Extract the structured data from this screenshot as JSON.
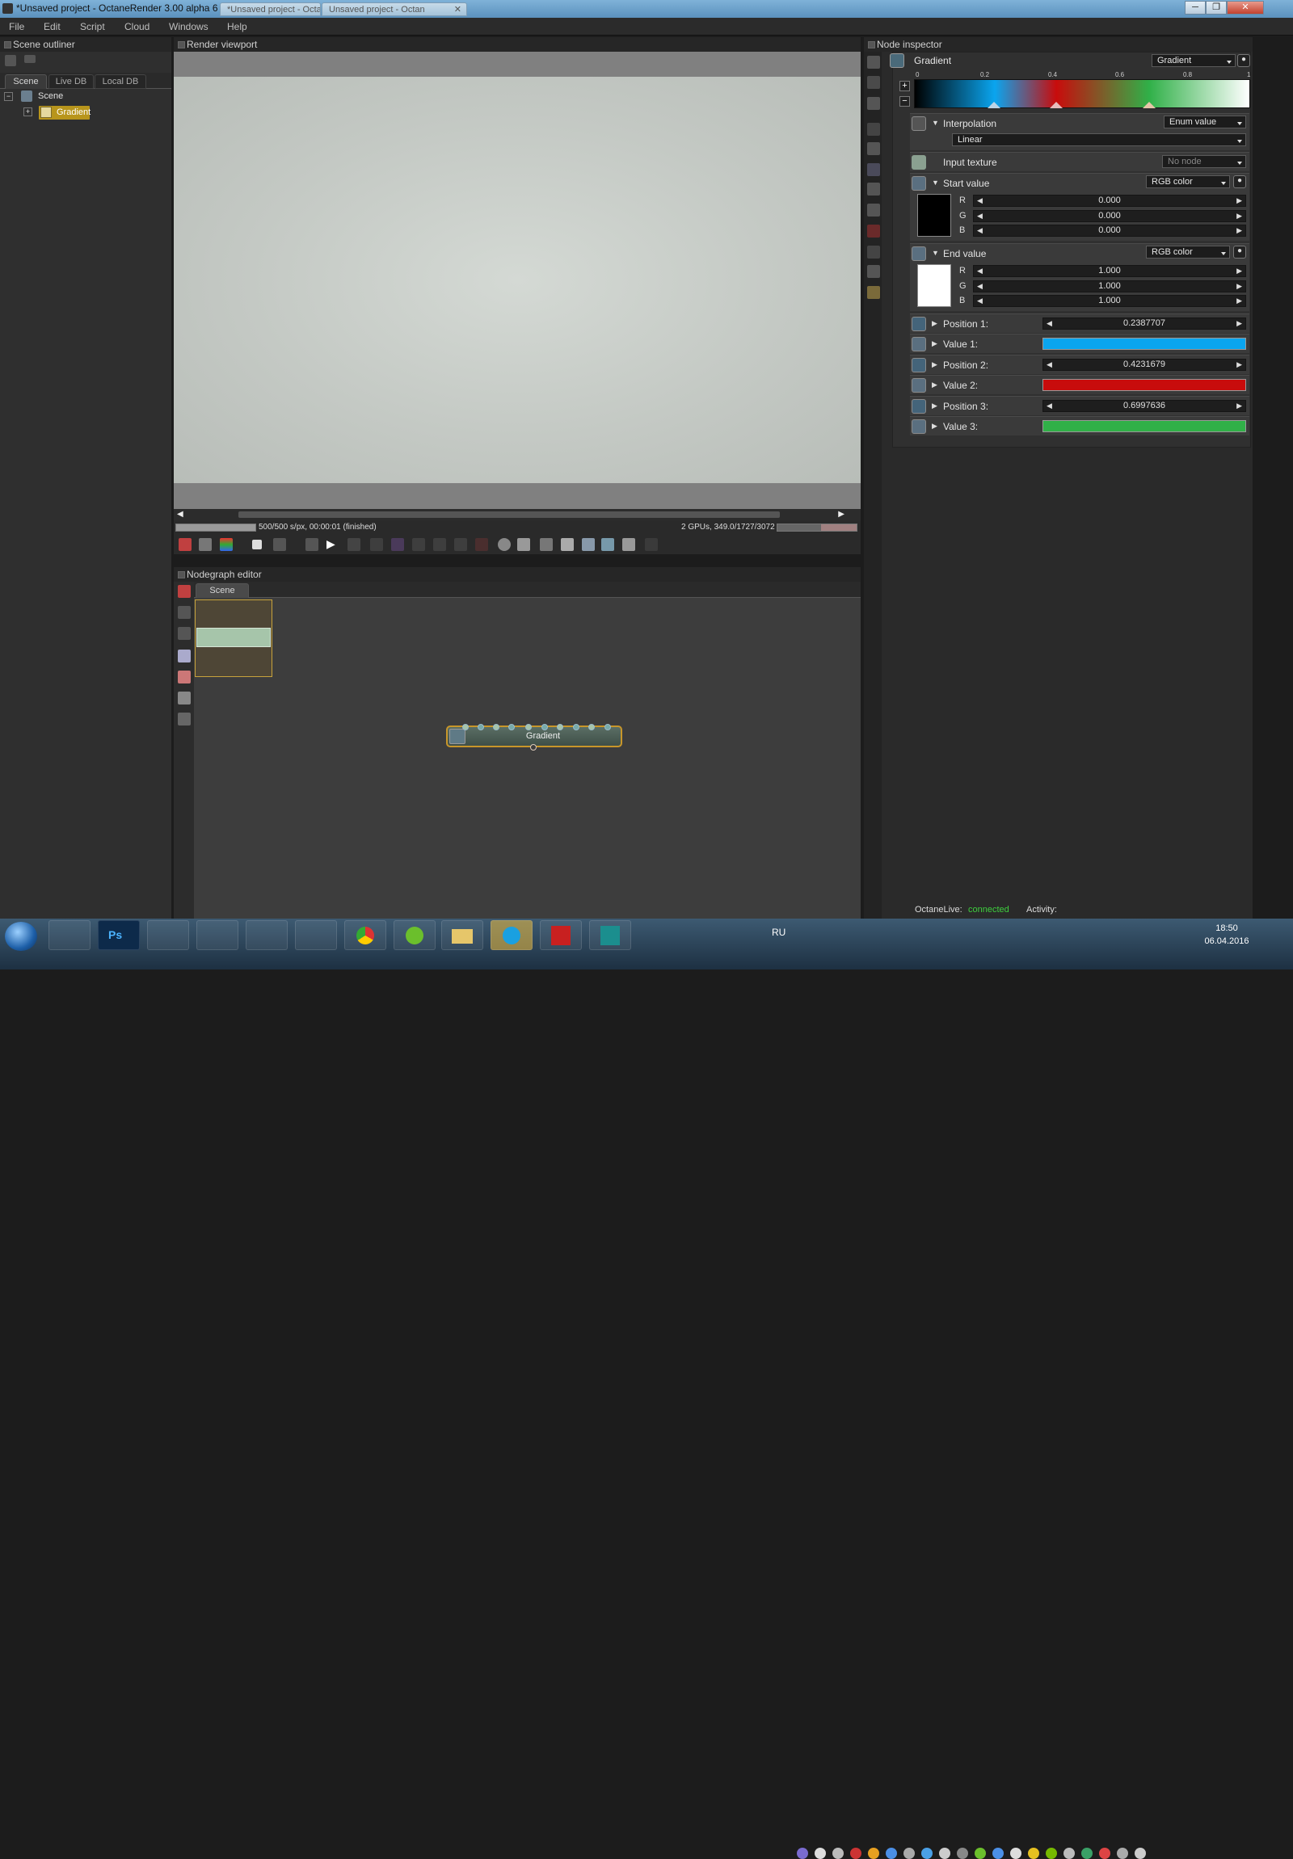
{
  "window": {
    "title": "*Unsaved project - OctaneRender 3.00 alpha 6",
    "browser_tab": "*Unsaved project - Octa",
    "browser_tab2": "Unsaved project - Octan",
    "buttons": [
      "─",
      "❐",
      "✕"
    ]
  },
  "menu": [
    "File",
    "Edit",
    "Script",
    "Cloud",
    "Windows",
    "Help"
  ],
  "outliner": {
    "title": "Scene outliner",
    "tabs": [
      "Scene",
      "Live DB",
      "Local DB"
    ],
    "tree": {
      "root": "Scene",
      "child": "Gradient"
    }
  },
  "viewport": {
    "title": "Render viewport",
    "status_left": "500/500 s/px, 00:00:01 (finished)",
    "status_right": "2 GPUs, 349.0/1727/3072 MB",
    "progress": 1.0,
    "gpu_mem_fraction": 0.55
  },
  "nodegraph": {
    "title": "Nodegraph editor",
    "tab": "Scene",
    "node_label": "Gradient"
  },
  "inspector": {
    "title": "Node inspector",
    "node_name": "Gradient",
    "node_type": "Gradient",
    "gradient_ticks": [
      "0",
      "0.2",
      "0.4",
      "0.6",
      "0.8",
      "1"
    ],
    "interpolation": {
      "label": "Interpolation",
      "type": "Enum value",
      "value": "Linear"
    },
    "input_texture": {
      "label": "Input texture",
      "value": "No node"
    },
    "start": {
      "label": "Start value",
      "type": "RGB color",
      "r": "0.000",
      "g": "0.000",
      "b": "0.000",
      "swatch": "#000000"
    },
    "end": {
      "label": "End value",
      "type": "RGB color",
      "r": "1.000",
      "g": "1.000",
      "b": "1.000",
      "swatch": "#ffffff"
    },
    "channels": [
      "R",
      "G",
      "B"
    ],
    "position1": {
      "label": "Position 1:",
      "value": "0.2387707"
    },
    "value1": {
      "label": "Value 1:",
      "color": "#0aa5ef"
    },
    "position2": {
      "label": "Position 2:",
      "value": "0.4231679"
    },
    "value2": {
      "label": "Value 2:",
      "color": "#c80c0c"
    },
    "position3": {
      "label": "Position 3:",
      "value": "0.6997636"
    },
    "value3": {
      "label": "Value 3:",
      "color": "#30b048"
    }
  },
  "statusbar": {
    "octanelive_label": "OctaneLive:",
    "octanelive_status": "connected",
    "activity_label": "Activity:"
  },
  "taskbar": {
    "lang": "RU",
    "time": "18:50",
    "date": "06.04.2016"
  }
}
